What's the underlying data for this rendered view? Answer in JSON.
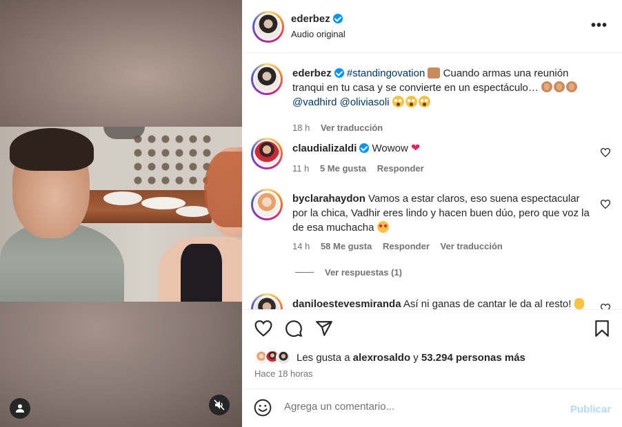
{
  "post": {
    "author": "ederbez",
    "audio": "Audio original",
    "more_label": "•••"
  },
  "caption": {
    "user": "ederbez",
    "hashtag": "#standingovation",
    "text_after_hashtag": " Cuando armas una reunión tranqui en tu casa y se convierte en un espectáculo…",
    "mention1": "@vadhird",
    "mention2": "@oliviasoli",
    "time": "18 h",
    "translate": "Ver traducción"
  },
  "comments": [
    {
      "user": "claudializaldi",
      "text": "Wowow",
      "time": "11 h",
      "likes": "5 Me gusta",
      "reply": "Responder"
    },
    {
      "user": "byclarahaydon",
      "text": "Vamos a estar claros, eso suena espectacular por la chica, Vadhir eres lindo y hacen buen dúo, pero que voz la de esa muchacha",
      "time": "14 h",
      "likes": "58 Me gusta",
      "reply": "Responder",
      "translate": "Ver traducción",
      "view_replies": "Ver respuestas (1)"
    },
    {
      "user": "daniloestevesmiranda",
      "text": "Así ni ganas de cantar le da al resto!"
    }
  ],
  "likes_summary": {
    "prefix": "Les gusta a ",
    "user": "alexrosaldo",
    "middle": " y ",
    "count": "53.294 personas más"
  },
  "posted": "Hace 18 horas",
  "add_comment": {
    "placeholder": "Agrega un comentario...",
    "publish": "Publicar"
  },
  "icons": {
    "like": "heart-icon",
    "comment": "comment-icon",
    "share": "share-icon",
    "save": "bookmark-icon",
    "emoji": "emoji-icon",
    "mute": "speaker-muted-icon",
    "user_tag": "person-icon",
    "verified": "verified-badge-icon"
  },
  "colors": {
    "verified": "#0095f6",
    "publish_disabled": "#b3dbff",
    "secondary_text": "#737373",
    "link": "#00376b",
    "heart_emoji": "#e0245e"
  }
}
